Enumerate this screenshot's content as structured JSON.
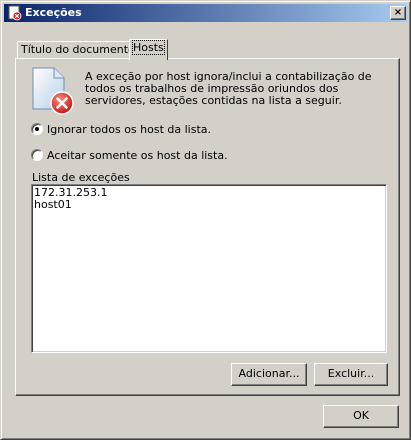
{
  "window": {
    "title": "Exceções",
    "close_symbol": "×"
  },
  "tabs": [
    {
      "label": "Título do documento",
      "active": false
    },
    {
      "label": "Hosts",
      "active": true
    }
  ],
  "info_text": "A exceção por host ignora/inclui a contabilização de todos os trabalhos de impressão oriundos dos servidores, estações contidas na lista a seguir.",
  "radios": [
    {
      "label": "Ignorar todos os host da lista.",
      "checked": true
    },
    {
      "label": "Aceitar somente os host da lista.",
      "checked": false
    }
  ],
  "list": {
    "label": "Lista de exceções",
    "items": [
      "172.31.253.1",
      "host01"
    ]
  },
  "buttons": {
    "add": "Adicionar...",
    "delete": "Excluir...",
    "ok": "OK"
  },
  "icons": {
    "app": "app-icon",
    "document": "document-error-icon"
  }
}
